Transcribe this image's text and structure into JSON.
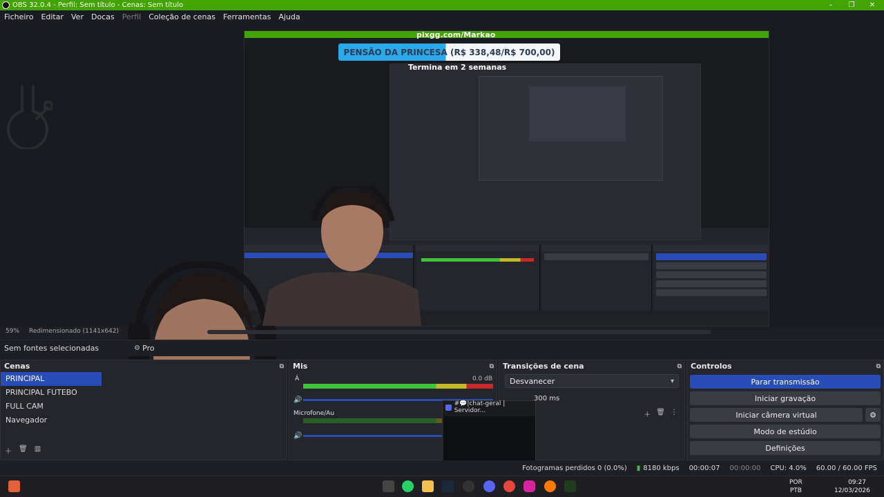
{
  "window": {
    "title": "OBS 32.0.4 - Perfil: Sem título - Cenas: Sem título",
    "controls": [
      "–",
      "❐",
      "✕"
    ]
  },
  "menu": {
    "items": [
      "Ficheiro",
      "Editar",
      "Ver",
      "Docas",
      "Perfil",
      "Coleção de cenas",
      "Ferramentas",
      "Ajuda"
    ]
  },
  "overlay": {
    "url": "pixgg.com/Markao",
    "goal_text": "PENSÃO DA PRINCESA (R$ 338,48/R$ 700,00)",
    "goal_progress": 0.4835,
    "ends_text": "Termina em 2 semanas"
  },
  "preview_status": {
    "zoom": "59%",
    "resize": "Redimensionado (1141x642)"
  },
  "sources_bar": {
    "no_source": "Sem fontes selecionadas",
    "properties": "Pro"
  },
  "scenes": {
    "title": "Cenas",
    "items": [
      {
        "label": "PRINCIPAL",
        "selected": true
      },
      {
        "label": "PRINCIPAL FUTEBO",
        "selected": false
      },
      {
        "label": "FULL CAM",
        "selected": false
      },
      {
        "label": "Navegador",
        "selected": false
      }
    ]
  },
  "mixer": {
    "title": "Mis",
    "tracks": [
      {
        "name": "Á",
        "db": "0.0 dB"
      },
      {
        "name": "Microfone/Au",
        "db": ""
      }
    ],
    "scale": [
      "-60",
      "-55",
      "-50",
      "-45",
      "-40",
      "-35",
      "-30",
      "-25",
      "-20",
      "-15",
      "-10",
      "-5",
      "0"
    ]
  },
  "transitions": {
    "title": "Transições de cena",
    "selected": "Desvanecer",
    "duration": "300 ms"
  },
  "controls": {
    "title": "Controlos",
    "buttons": [
      "Parar transmissão",
      "Iniciar gravação",
      "Iniciar câmera virtual",
      "Modo de estúdio",
      "Definições"
    ]
  },
  "chat_popup": {
    "title": "#💬|chat-geral | Servidor..."
  },
  "status": {
    "dropped": "Fotogramas perdidos 0 (0.0%)",
    "kbps": "8180 kbps",
    "stream_time": "00:00:07",
    "rec_time": "00:00:00",
    "cpu": "CPU: 4.0%",
    "fps": "60.00 / 60.00 FPS"
  },
  "taskbar": {
    "lang_top": "POR",
    "lang_bottom": "PTB",
    "time": "09:27",
    "date": "12/03/2026"
  },
  "colors": {
    "title_green": "#43a300",
    "selection_blue": "#284cb8",
    "meter_green": "#3fc33b",
    "meter_yellow": "#c2b92a",
    "meter_red": "#c62a2a"
  }
}
